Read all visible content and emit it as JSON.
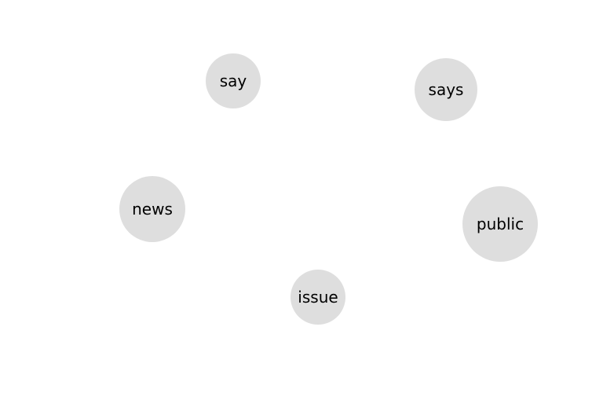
{
  "nodes": [
    {
      "label": "say"
    },
    {
      "label": "says"
    },
    {
      "label": "news"
    },
    {
      "label": "public"
    },
    {
      "label": "issue"
    }
  ],
  "colors": {
    "node_fill": "#dedede",
    "label_text": "#000000",
    "background": "#ffffff"
  }
}
